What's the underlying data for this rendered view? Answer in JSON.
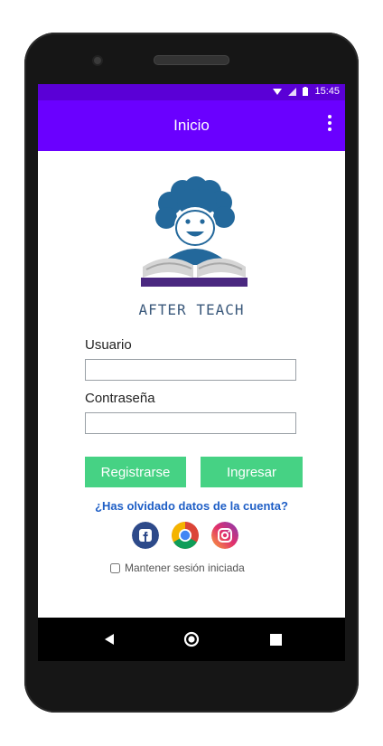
{
  "status_bar": {
    "time": "15:45",
    "icons": [
      "wifi-icon",
      "signal-icon",
      "battery-icon"
    ]
  },
  "app_bar": {
    "title": "Inicio",
    "menu_icon": "overflow-menu-icon"
  },
  "logo": {
    "brand_text": "AFTER TEACH"
  },
  "form": {
    "username_label": "Usuario",
    "username_value": "",
    "password_label": "Contraseña",
    "password_value": "",
    "register_label": "Registrarse",
    "login_label": "Ingresar",
    "forgot_link": "¿Has olvidado datos de la cuenta?",
    "keep_session_label": "Mantener sesión iniciada"
  },
  "social": [
    "facebook-icon",
    "chrome-icon",
    "instagram-icon"
  ],
  "colors": {
    "status_bar": "#5a00d6",
    "app_bar": "#6a00ff",
    "button": "#46d284",
    "link": "#1f5fc6"
  }
}
